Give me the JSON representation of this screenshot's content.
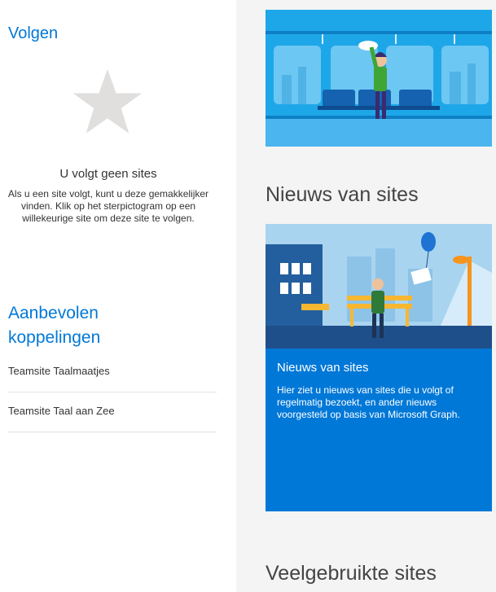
{
  "follow": {
    "heading": "Volgen",
    "empty_title": "U volgt geen sites",
    "empty_desc": "Als u een site volgt, kunt u deze gemakkelijker vinden. Klik op het sterpictogram op een willekeurige site om deze site te volgen."
  },
  "recommended": {
    "heading": "Aanbevolen koppelingen",
    "links": [
      "Teamsite Taalmaatjes",
      "Teamsite Taal aan Zee"
    ]
  },
  "news": {
    "section_title": "Nieuws van sites",
    "card_title": "Nieuws van sites",
    "card_desc": "Hier ziet u nieuws van sites die u volgt of regelmatig bezoekt, en ander nieuws voorgesteld op basis van Microsoft Graph."
  },
  "frequent": {
    "section_title": "Veelgebruikte sites"
  },
  "colors": {
    "accent": "#0078d7",
    "right_bg": "#f4f4f4"
  }
}
